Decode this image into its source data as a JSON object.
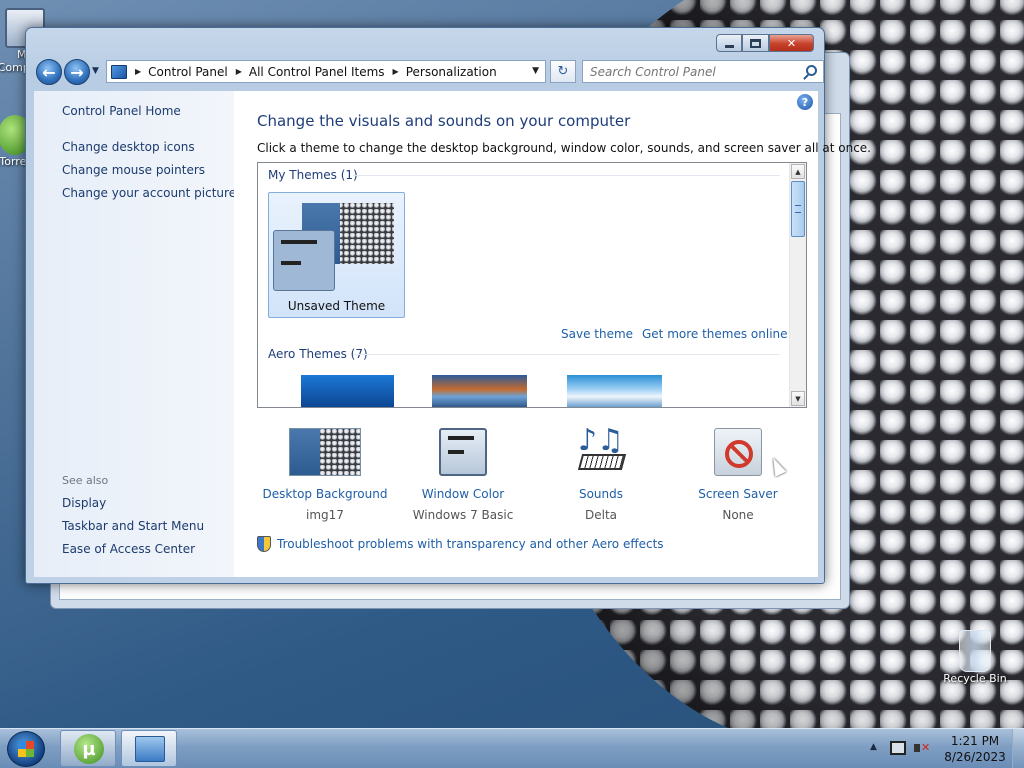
{
  "desktop": {
    "icons": [
      {
        "label": "My Computer",
        "icon": "computer-icon"
      },
      {
        "label": "µTorrent",
        "icon": "utorrent-icon"
      },
      {
        "label": "Recycle Bin",
        "icon": "recycle-bin-icon"
      }
    ]
  },
  "window": {
    "caption_buttons": {
      "minimize": "minimize-icon",
      "maximize": "maximize-icon",
      "close": "✕"
    },
    "navigation": {
      "back_glyph": "←",
      "forward_glyph": "→",
      "history_glyph": "▼",
      "breadcrumb": [
        "Control Panel",
        "All Control Panel Items",
        "Personalization"
      ],
      "crumb_separator": "▶",
      "dropdown_glyph": "▼",
      "refresh_glyph": "↻",
      "search_placeholder": "Search Control Panel"
    },
    "left_pane": {
      "home_link": "Control Panel Home",
      "tasks": [
        "Change desktop icons",
        "Change mouse pointers",
        "Change your account picture"
      ],
      "see_also_title": "See also",
      "see_also_links": [
        "Display",
        "Taskbar and Start Menu",
        "Ease of Access Center"
      ]
    },
    "content": {
      "help_glyph": "?",
      "title": "Change the visuals and sounds on your computer",
      "subtitle": "Click a theme to change the desktop background, window color, sounds, and screen saver all at once.",
      "my_themes_label": "My Themes (1)",
      "selected_theme": "Unsaved Theme",
      "save_theme_link": "Save theme",
      "more_themes_link": "Get more themes online",
      "aero_themes_label": "Aero Themes (7)",
      "scroll_up_glyph": "▲",
      "scroll_down_glyph": "▼",
      "settings": [
        {
          "label": "Desktop Background",
          "value": "img17"
        },
        {
          "label": "Window Color",
          "value": "Windows 7 Basic"
        },
        {
          "label": "Sounds",
          "value": "Delta"
        },
        {
          "label": "Screen Saver",
          "value": "None"
        }
      ],
      "sounds_glyph": "♪♫",
      "troubleshoot_link": "Troubleshoot problems with transparency and other Aero effects"
    }
  },
  "taskbar": {
    "utorrent_glyph": "µ",
    "tray_arrow_glyph": "▲",
    "clock_time": "1:21 PM",
    "clock_date": "8/26/2023"
  }
}
